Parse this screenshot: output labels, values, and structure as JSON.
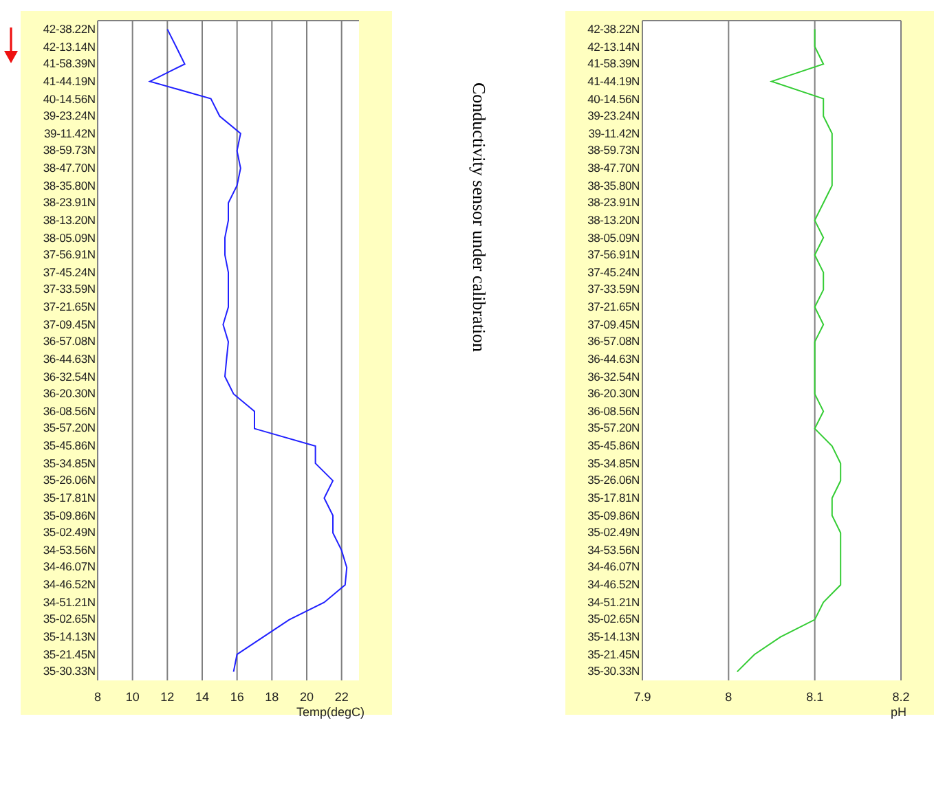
{
  "charts": [
    {
      "chart_data": {
        "type": "line",
        "orientation": "horizontal",
        "xlabel": "Temp(degC)",
        "categories": [
          "42-38.22N",
          "42-13.14N",
          "41-58.39N",
          "41-44.19N",
          "40-14.56N",
          "39-23.24N",
          "39-11.42N",
          "38-59.73N",
          "38-47.70N",
          "38-35.80N",
          "38-23.91N",
          "38-13.20N",
          "38-05.09N",
          "37-56.91N",
          "37-45.24N",
          "37-33.59N",
          "37-21.65N",
          "37-09.45N",
          "36-57.08N",
          "36-44.63N",
          "36-32.54N",
          "36-20.30N",
          "36-08.56N",
          "35-57.20N",
          "35-45.86N",
          "35-34.85N",
          "35-26.06N",
          "35-17.81N",
          "35-09.86N",
          "35-02.49N",
          "34-53.56N",
          "34-46.07N",
          "34-46.52N",
          "34-51.21N",
          "35-02.65N",
          "35-14.13N",
          "35-21.45N",
          "35-30.33N"
        ],
        "series": [
          {
            "color": "#2020ff",
            "values": [
              12,
              12.5,
              13,
              11,
              14.5,
              15,
              16.2,
              16,
              16.2,
              16,
              15.5,
              15.5,
              15.3,
              15.3,
              15.5,
              15.5,
              15.5,
              15.2,
              15.5,
              15.4,
              15.3,
              15.8,
              17,
              17,
              20.5,
              20.5,
              21.5,
              21,
              21.5,
              21.5,
              22,
              22.3,
              22.2,
              21,
              19,
              17.5,
              16,
              15.8
            ]
          }
        ],
        "xlim": [
          8,
          23
        ],
        "xticks": [
          8,
          10,
          12,
          14,
          16,
          18,
          20,
          22
        ],
        "grid": true
      }
    },
    {
      "chart_data": {
        "type": "line",
        "orientation": "horizontal",
        "xlabel": "pH",
        "categories": [
          "42-38.22N",
          "42-13.14N",
          "41-58.39N",
          "41-44.19N",
          "40-14.56N",
          "39-23.24N",
          "39-11.42N",
          "38-59.73N",
          "38-47.70N",
          "38-35.80N",
          "38-23.91N",
          "38-13.20N",
          "38-05.09N",
          "37-56.91N",
          "37-45.24N",
          "37-33.59N",
          "37-21.65N",
          "37-09.45N",
          "36-57.08N",
          "36-44.63N",
          "36-32.54N",
          "36-20.30N",
          "36-08.56N",
          "35-57.20N",
          "35-45.86N",
          "35-34.85N",
          "35-26.06N",
          "35-17.81N",
          "35-09.86N",
          "35-02.49N",
          "34-53.56N",
          "34-46.07N",
          "34-46.52N",
          "34-51.21N",
          "35-02.65N",
          "35-14.13N",
          "35-21.45N",
          "35-30.33N"
        ],
        "series": [
          {
            "color": "#33cc33",
            "values": [
              8.1,
              8.1,
              8.11,
              8.05,
              8.11,
              8.11,
              8.12,
              8.12,
              8.12,
              8.12,
              8.11,
              8.1,
              8.11,
              8.1,
              8.11,
              8.11,
              8.1,
              8.11,
              8.1,
              8.1,
              8.1,
              8.1,
              8.11,
              8.1,
              8.12,
              8.13,
              8.13,
              8.12,
              8.12,
              8.13,
              8.13,
              8.13,
              8.13,
              8.11,
              8.1,
              8.06,
              8.03,
              8.01
            ]
          }
        ],
        "xlim": [
          7.9,
          8.2
        ],
        "xticks": [
          7.9,
          8,
          8.1,
          8.2
        ],
        "grid": true
      }
    }
  ],
  "annotation": "Conductivity sensor under calibration"
}
